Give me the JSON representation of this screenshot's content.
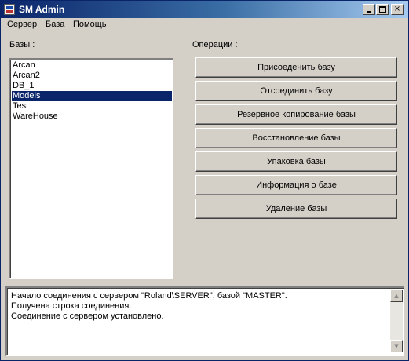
{
  "window": {
    "title": "SM Admin",
    "caption_buttons": {
      "minimize": "_",
      "maximize": "□",
      "close": "×"
    }
  },
  "menu": {
    "items": [
      {
        "label": "Сервер"
      },
      {
        "label": "База"
      },
      {
        "label": "Помощь"
      }
    ]
  },
  "databases": {
    "label": "Базы :",
    "items": [
      {
        "label": "Arcan",
        "selected": false
      },
      {
        "label": "Arcan2",
        "selected": false
      },
      {
        "label": "DB_1",
        "selected": false
      },
      {
        "label": "Models",
        "selected": true
      },
      {
        "label": "Test",
        "selected": false
      },
      {
        "label": "WareHouse",
        "selected": false
      }
    ]
  },
  "operations": {
    "label": "Операции :",
    "buttons": [
      {
        "label": "Присоеденить базу"
      },
      {
        "label": "Отсоединить базу"
      },
      {
        "label": "Резервное копирование базы"
      },
      {
        "label": "Восстановление базы"
      },
      {
        "label": "Упаковка базы"
      },
      {
        "label": "Информация о базе"
      },
      {
        "label": "Удаление базы"
      }
    ]
  },
  "log": {
    "lines": [
      "Начало соединения с сервером \"Roland\\SERVER\", базой \"MASTER\".",
      "Получена строка соединения.",
      "Соединение с сервером установлено."
    ]
  },
  "scrollbar": {
    "up_arrow": "▲",
    "down_arrow": "▼"
  },
  "colors": {
    "title_gradient_start": "#0a246a",
    "title_gradient_end": "#a6caf0",
    "selection": "#0a246a",
    "face": "#d4d0c8"
  }
}
